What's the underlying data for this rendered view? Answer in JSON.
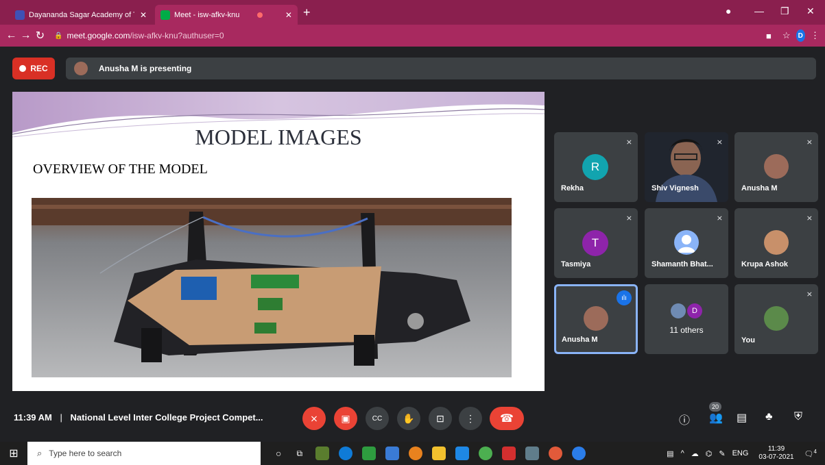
{
  "browser": {
    "tabs": [
      {
        "title": "Dayananda Sagar Academy of Te",
        "active": false
      },
      {
        "title": "Meet - isw-afkv-knu",
        "active": true
      }
    ],
    "url_host": "meet.google.com",
    "url_path": "/isw-afkv-knu?authuser=0",
    "profile_initial": "D"
  },
  "meet": {
    "rec_label": "REC",
    "presenting_text": "Anusha M is presenting",
    "time": "11:39 AM",
    "separator": "|",
    "meeting_title": "National Level Inter College Project Compet...",
    "participant_count": "20",
    "others_label": "11 others",
    "others_initial": "D"
  },
  "slide": {
    "title": "MODEL IMAGES",
    "subtitle": "OVERVIEW OF THE MODEL"
  },
  "participants": [
    {
      "name": "Rekha",
      "initial": "R",
      "color": "#12a4af"
    },
    {
      "name": "Shiv Vignesh",
      "initial": "",
      "color": ""
    },
    {
      "name": "Anusha M",
      "initial": "",
      "color": ""
    },
    {
      "name": "Tasmiya",
      "initial": "T",
      "color": "#8e24aa"
    },
    {
      "name": "Shamanth Bhat...",
      "initial": "",
      "color": ""
    },
    {
      "name": "Krupa Ashok",
      "initial": "",
      "color": ""
    },
    {
      "name": "Anusha M",
      "initial": "",
      "color": ""
    },
    {
      "name": "11 others",
      "initial": "",
      "color": ""
    },
    {
      "name": "You",
      "initial": "",
      "color": ""
    }
  ],
  "taskbar": {
    "search_placeholder": "Type here to search",
    "lang": "ENG",
    "time": "11:39",
    "date": "03-07-2021",
    "notif_count": "4"
  }
}
